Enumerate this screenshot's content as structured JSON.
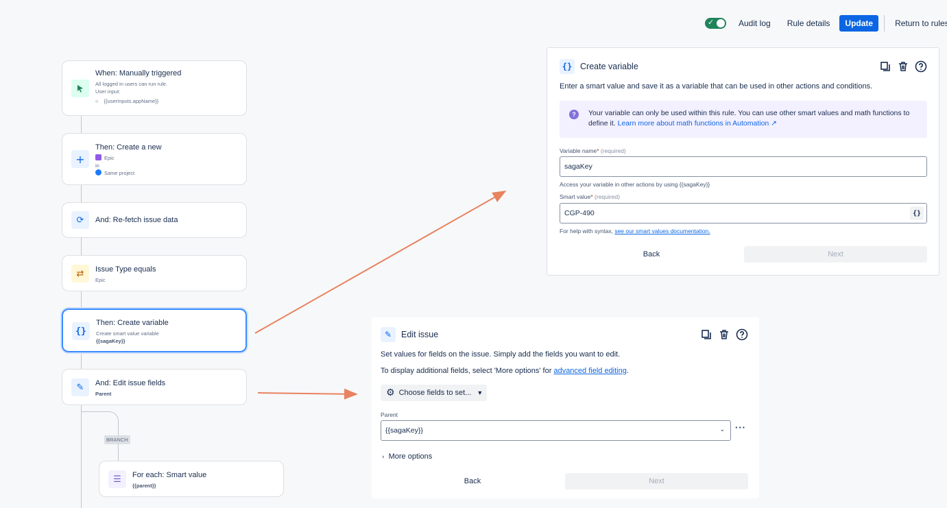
{
  "topbar": {
    "audit_log": "Audit log",
    "rule_details": "Rule details",
    "update": "Update",
    "return": "Return to rules"
  },
  "flow": {
    "trigger": {
      "title": "When: Manually triggered",
      "line1": "All logged in users can run rule.",
      "line2": "User input:",
      "input": "{{userInputs.appName}}"
    },
    "create_new": {
      "title": "Then: Create a new",
      "type": "Epic",
      "in": "in",
      "project": "Same project"
    },
    "refetch": {
      "title": "And: Re-fetch issue data"
    },
    "condition": {
      "title": "Issue Type equals",
      "value": "Epic"
    },
    "create_var": {
      "title": "Then: Create variable",
      "line1": "Create smart value variable",
      "line2": "{{sagaKey}}"
    },
    "edit_fields": {
      "title": "And: Edit issue fields",
      "value": "Parent"
    },
    "branch_tag": "BRANCH",
    "foreach": {
      "title": "For each: Smart value",
      "value": "{{parent}}"
    }
  },
  "create_variable_panel": {
    "title": "Create variable",
    "description": "Enter a smart value and save it as a variable that can be used in other actions and conditions.",
    "note_text": "Your variable can only be used within this rule. You can use other smart values and math functions to define it.",
    "note_link": "Learn more about math functions in Automation ↗",
    "name_label": "Variable name",
    "required": "(required)",
    "name_value": "sagaKey",
    "name_help": "Access your variable in other actions by using {{sagaKey}}",
    "smart_label": "Smart value",
    "smart_value": "CGP-490",
    "smart_help_prefix": "For help with syntax, ",
    "smart_help_link": "see our smart values documentation.",
    "back": "Back",
    "next": "Next"
  },
  "edit_issue_panel": {
    "title": "Edit issue",
    "description": "Set values for fields on the issue. Simply add the fields you want to edit.",
    "more_prefix": "To display additional fields, select 'More options' for ",
    "more_link": "advanced field editing",
    "more_suffix": ".",
    "choose_fields": "Choose fields to set...",
    "parent_label": "Parent",
    "parent_value": "{{sagaKey}}",
    "more_options": "More options",
    "back": "Back",
    "next": "Next"
  },
  "colors": {
    "accent": "#0c66e4",
    "toggle_on": "#1f845a",
    "arrow": "#e8825f",
    "note_bg": "#f3f0ff"
  }
}
